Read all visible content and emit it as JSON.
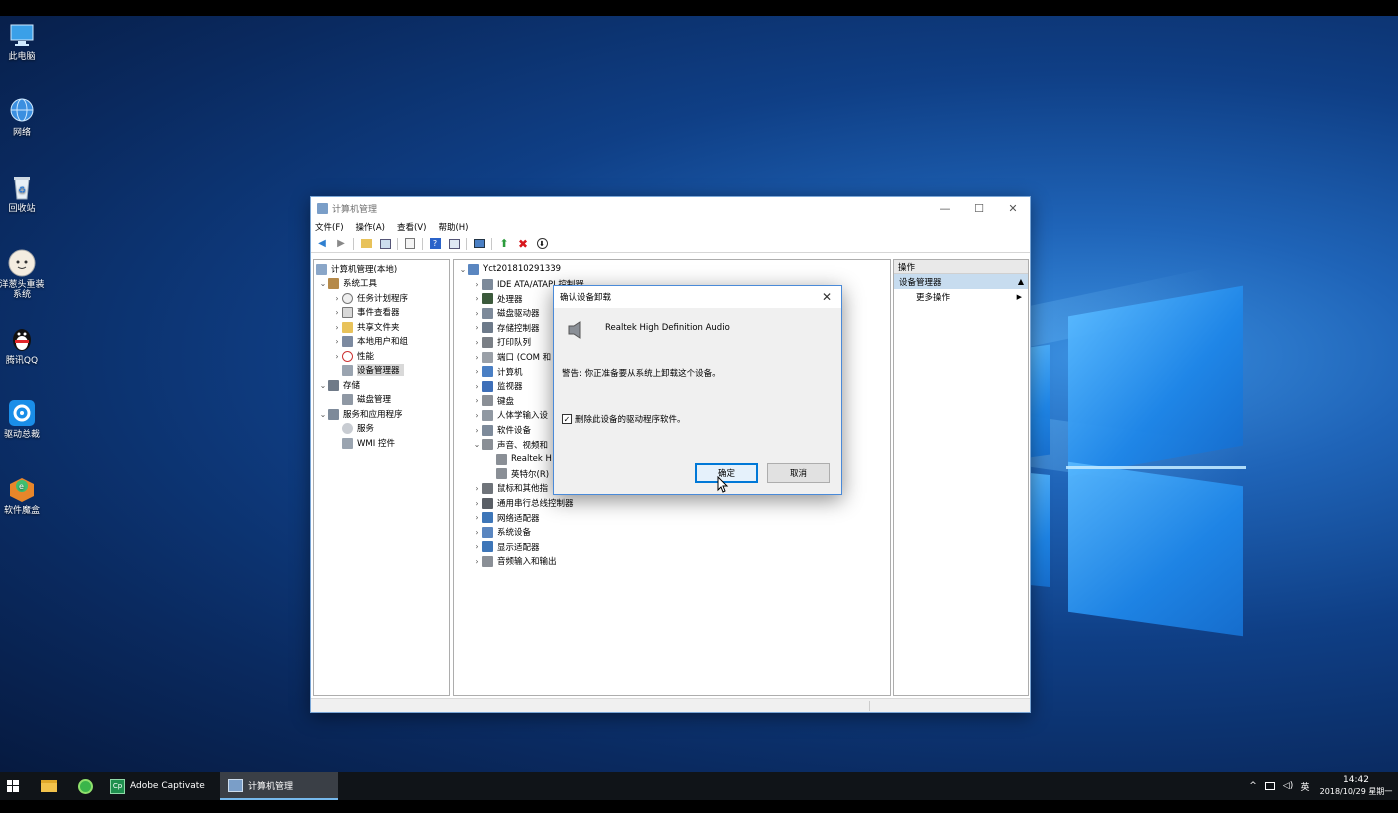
{
  "desktop": {
    "icons": [
      {
        "label": "此电脑"
      },
      {
        "label": "网络"
      },
      {
        "label": "回收站"
      },
      {
        "label": "洋葱头重装系统"
      },
      {
        "label": "腾讯QQ"
      },
      {
        "label": "驱动总裁"
      },
      {
        "label": "软件魔盒"
      }
    ]
  },
  "window": {
    "title": "计算机管理",
    "menu": [
      "文件(F)",
      "操作(A)",
      "查看(V)",
      "帮助(H)"
    ],
    "left_tree": {
      "root": "计算机管理(本地)",
      "system_tools": "系统工具",
      "task_scheduler": "任务计划程序",
      "event_viewer": "事件查看器",
      "shared_folders": "共享文件夹",
      "local_users": "本地用户和组",
      "performance": "性能",
      "device_manager": "设备管理器",
      "storage": "存储",
      "disk_management": "磁盘管理",
      "services_apps": "服务和应用程序",
      "services": "服务",
      "wmi": "WMI 控件"
    },
    "device_tree": {
      "computer_name": "Yct201810291339",
      "items": [
        "IDE ATA/ATAPI 控制器",
        "处理器",
        "磁盘驱动器",
        "存储控制器",
        "打印队列",
        "端口 (COM 和",
        "计算机",
        "监视器",
        "键盘",
        "人体学输入设",
        "软件设备",
        "声音、视频和",
        "Realtek H",
        "英特尔(R)",
        "鼠标和其他指",
        "通用串行总线控制器",
        "网络适配器",
        "系统设备",
        "显示适配器",
        "音频输入和输出"
      ]
    },
    "actions": {
      "header": "操作",
      "section": "设备管理器",
      "more": "更多操作"
    }
  },
  "dialog": {
    "title": "确认设备卸载",
    "device_name": "Realtek High Definition Audio",
    "warning": "警告: 你正准备要从系统上卸载这个设备。",
    "checkbox_label": "删除此设备的驱动程序软件。",
    "checkbox_checked": true,
    "ok_label": "确定",
    "cancel_label": "取消"
  },
  "taskbar": {
    "apps": [
      {
        "label": "Adobe Captivate"
      },
      {
        "label": "计算机管理"
      }
    ],
    "ime": "英",
    "time": "14:42",
    "date": "2018/10/29 星期一"
  },
  "colors": {
    "accent": "#0078d7",
    "taskbar": "#101418",
    "selection": "#d9d9d9"
  }
}
